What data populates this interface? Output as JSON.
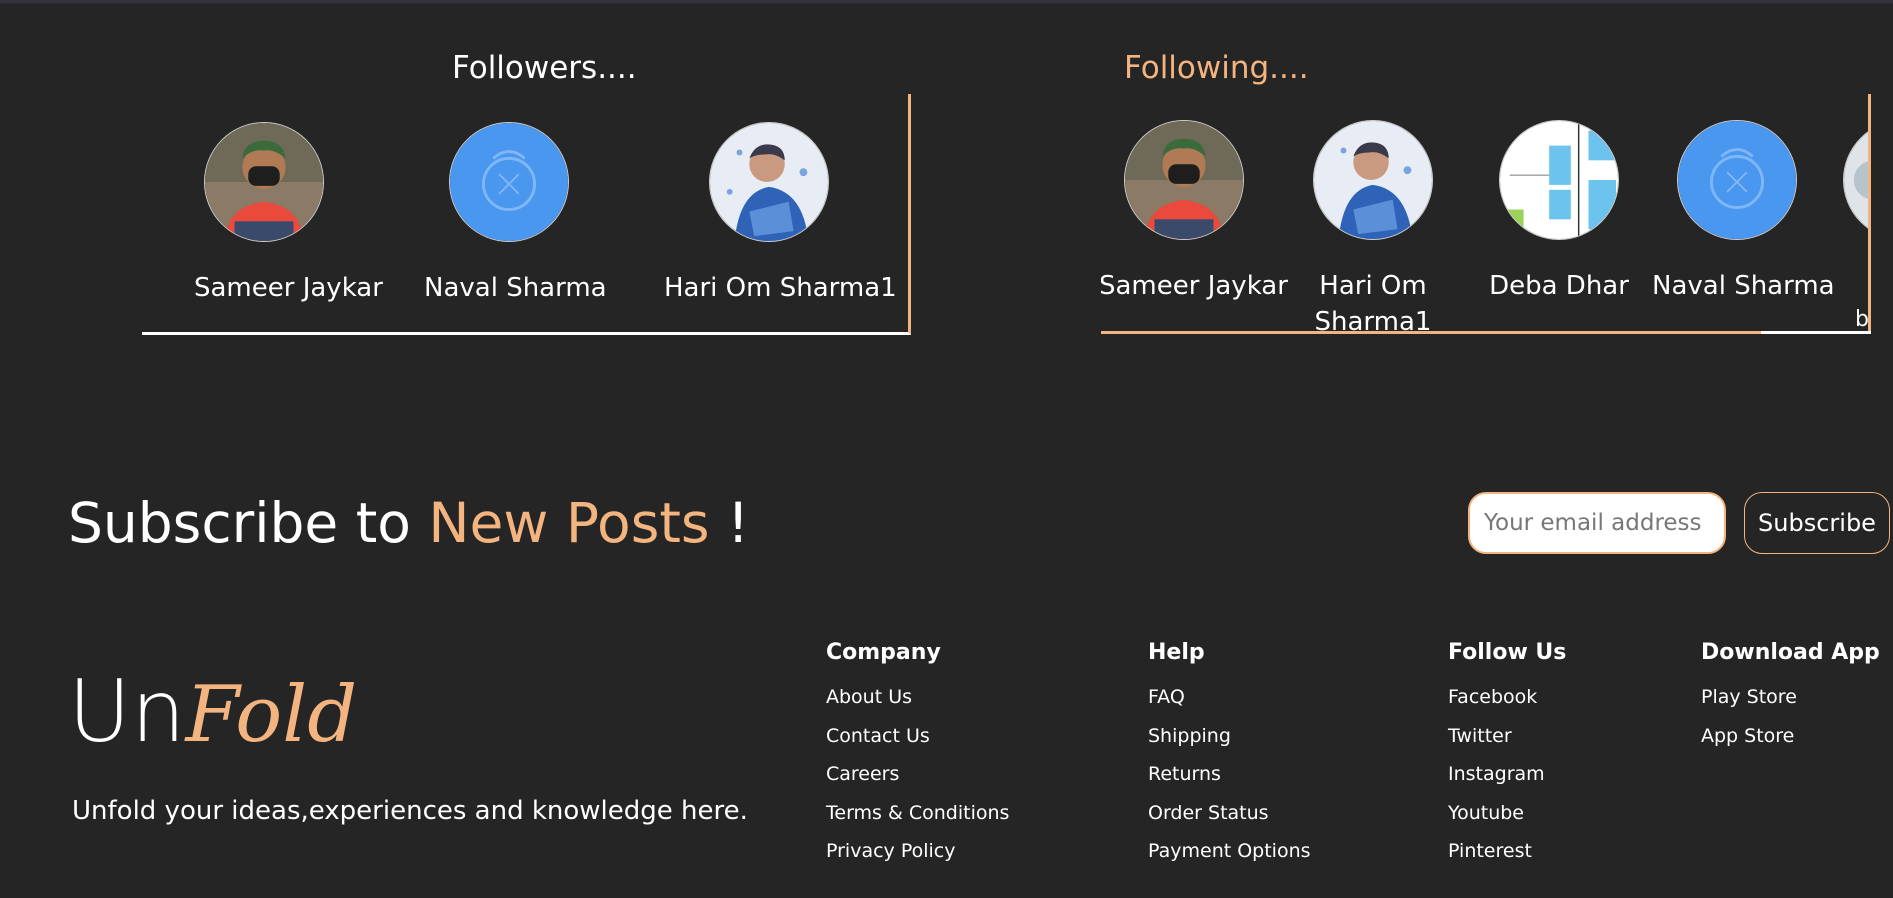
{
  "followers": {
    "title": "Followers....",
    "people": [
      {
        "name": "Sameer Jaykar",
        "avatar": "masked-man-photo"
      },
      {
        "name": "Naval Sharma",
        "avatar": "blue-crest-photo"
      },
      {
        "name": "Hari Om Sharma1",
        "avatar": "footballer-photo"
      }
    ]
  },
  "following": {
    "title": "Following....",
    "people": [
      {
        "name": "Sameer Jaykar",
        "avatar": "masked-man-photo"
      },
      {
        "name": "Hari Om Sharma1",
        "avatar": "footballer-photo"
      },
      {
        "name": "Deba Dhar",
        "avatar": "floorplan-photo"
      },
      {
        "name": "Naval Sharma",
        "avatar": "blue-crest-photo"
      }
    ],
    "partial_name_fragment": "b"
  },
  "subscribe": {
    "heading_prefix": "Subscribe to",
    "heading_accent": "New Posts",
    "heading_suffix": "!",
    "email_placeholder": "Your email address",
    "button_label": "Subscribe"
  },
  "brand": {
    "logo_un": "Un",
    "logo_fold": "Fold",
    "tagline": "Unfold your ideas,experiences and knowledge here."
  },
  "footer": {
    "company": {
      "title": "Company",
      "links": [
        "About Us",
        "Contact Us",
        "Careers",
        "Terms & Conditions",
        "Privacy Policy"
      ]
    },
    "help": {
      "title": "Help",
      "links": [
        "FAQ",
        "Shipping",
        "Returns",
        "Order Status",
        "Payment Options"
      ]
    },
    "follow": {
      "title": "Follow Us",
      "links": [
        "Facebook",
        "Twitter",
        "Instagram",
        "Youtube",
        "Pinterest"
      ]
    },
    "download": {
      "title": "Download App",
      "links": [
        "Play Store",
        "App Store"
      ]
    }
  },
  "colors": {
    "background": "#252525",
    "accent": "#f4b47f",
    "text": "#ffffff"
  }
}
